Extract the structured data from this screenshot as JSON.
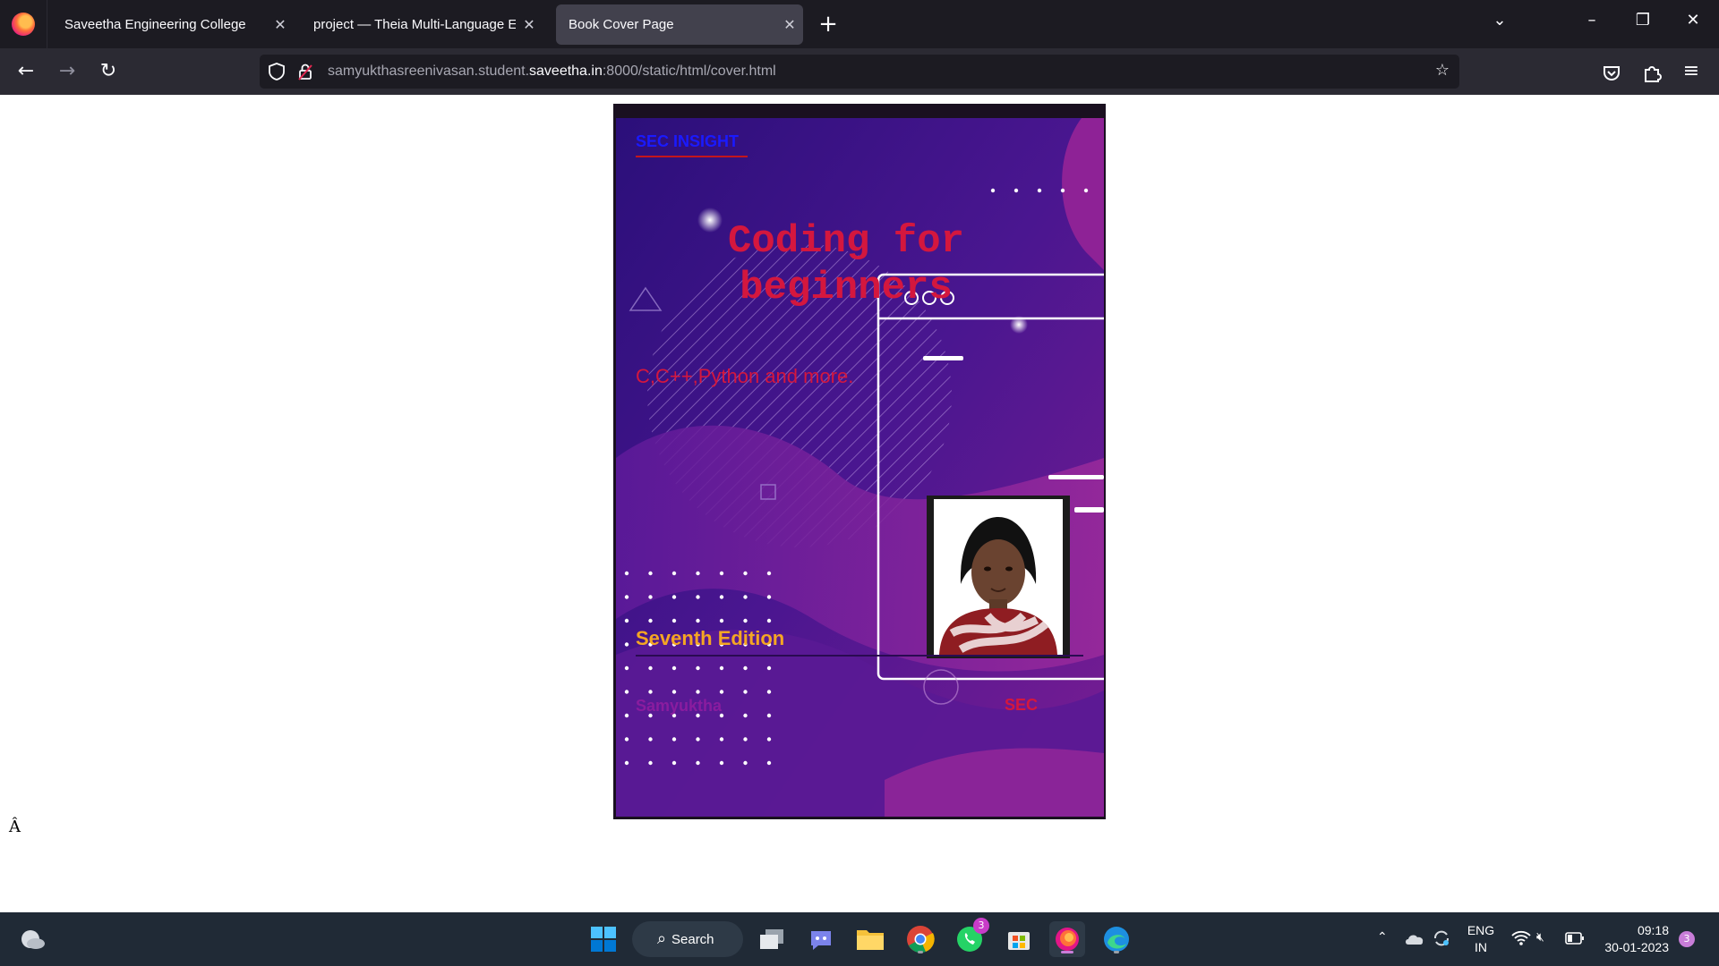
{
  "browser": {
    "tabs": [
      {
        "title": "Saveetha Engineering College"
      },
      {
        "title": "project — Theia Multi-Language Ex"
      },
      {
        "title": "Book Cover Page"
      }
    ],
    "url_prefix": "samyukthasreenivasan.student.",
    "url_host": "saveetha.in",
    "url_suffix": ":8000/static/html/cover.html"
  },
  "cover": {
    "brand": "SEC INSIGHT",
    "title": "Coding for beginners",
    "subtitle": "C,C++,Python and more.",
    "edition": "Seventh Edition",
    "author": "Samyuktha",
    "publisher": "SEC"
  },
  "page": {
    "stray_text": "Â"
  },
  "taskbar": {
    "search_label": "Search",
    "whatsapp_badge": "3",
    "lang_top": "ENG",
    "lang_bottom": "IN",
    "time": "09:18",
    "date": "30-01-2023",
    "notification_count": "3"
  },
  "colors": {
    "cover_purple_dark": "#3a1078",
    "cover_magenta": "#8e2296",
    "title_red": "#d4173e",
    "edition_orange": "#f5a623",
    "brand_blue": "#1a1aff"
  }
}
